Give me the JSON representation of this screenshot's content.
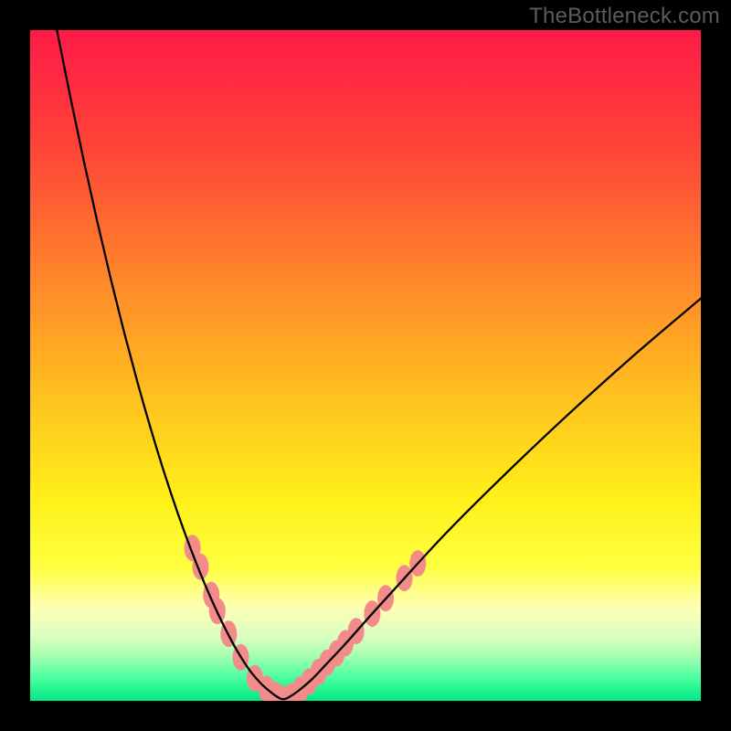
{
  "watermark": "TheBottleneck.com",
  "chart_data": {
    "type": "line",
    "title": "",
    "xlabel": "",
    "ylabel": "",
    "xlim": [
      0,
      100
    ],
    "ylim": [
      0,
      100
    ],
    "background": {
      "type": "vertical-gradient",
      "stops": [
        {
          "offset": 0.0,
          "color": "#ff1a48"
        },
        {
          "offset": 0.18,
          "color": "#ff4538"
        },
        {
          "offset": 0.38,
          "color": "#ff8a2a"
        },
        {
          "offset": 0.55,
          "color": "#ffc21e"
        },
        {
          "offset": 0.7,
          "color": "#fff019"
        },
        {
          "offset": 0.8,
          "color": "#ffff40"
        },
        {
          "offset": 0.86,
          "color": "#ffffb4"
        },
        {
          "offset": 0.905,
          "color": "#d9ffc0"
        },
        {
          "offset": 0.935,
          "color": "#a0ffb0"
        },
        {
          "offset": 0.965,
          "color": "#4cffa0"
        },
        {
          "offset": 1.0,
          "color": "#00e884"
        }
      ]
    },
    "series": [
      {
        "name": "bottleneck-curve",
        "color": "#000000",
        "stroke_width": 2.3,
        "x": [
          4,
          6,
          8,
          10,
          12,
          14,
          16,
          18,
          20,
          22,
          24,
          26,
          28,
          30,
          31.5,
          33,
          34.5,
          36,
          37,
          37.7,
          38.5,
          40,
          42,
          44,
          47,
          51,
          56,
          62,
          70,
          80,
          90,
          100
        ],
        "y": [
          100,
          90,
          80.5,
          71.5,
          63,
          55,
          47.5,
          40.5,
          34,
          28,
          22.5,
          17.5,
          13,
          9,
          6.4,
          4.2,
          2.5,
          1.2,
          0.5,
          0.25,
          0.5,
          1.5,
          3.2,
          5.3,
          8.5,
          13,
          18.5,
          25,
          33,
          42.5,
          51.5,
          60
        ]
      }
    ],
    "scatter": {
      "name": "highlight-points",
      "color": "#f38b8b",
      "radius": 9,
      "capsule_aspect": 1.6,
      "points": [
        {
          "x": 24.2,
          "y": 22.8
        },
        {
          "x": 25.4,
          "y": 20.0
        },
        {
          "x": 27.0,
          "y": 15.8
        },
        {
          "x": 27.9,
          "y": 13.4
        },
        {
          "x": 29.6,
          "y": 10.0
        },
        {
          "x": 31.4,
          "y": 6.5
        },
        {
          "x": 33.5,
          "y": 3.4
        },
        {
          "x": 35.2,
          "y": 1.8
        },
        {
          "x": 36.5,
          "y": 0.9
        },
        {
          "x": 37.7,
          "y": 0.3
        },
        {
          "x": 39.0,
          "y": 0.7
        },
        {
          "x": 40.3,
          "y": 1.7
        },
        {
          "x": 41.6,
          "y": 2.9
        },
        {
          "x": 43.0,
          "y": 4.3
        },
        {
          "x": 44.3,
          "y": 5.7
        },
        {
          "x": 45.7,
          "y": 7.1
        },
        {
          "x": 47.0,
          "y": 8.6
        },
        {
          "x": 48.6,
          "y": 10.4
        },
        {
          "x": 51.0,
          "y": 13.0
        },
        {
          "x": 53.0,
          "y": 15.3
        },
        {
          "x": 55.8,
          "y": 18.3
        },
        {
          "x": 57.8,
          "y": 20.5
        }
      ]
    }
  }
}
